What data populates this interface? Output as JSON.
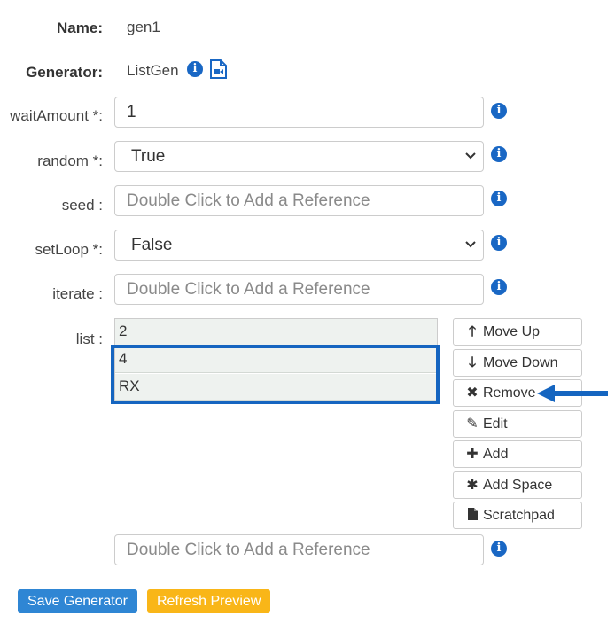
{
  "name": {
    "label": "Name:",
    "value": "gen1"
  },
  "generator": {
    "label": "Generator:",
    "value": "ListGen"
  },
  "fields": {
    "waitAmount": {
      "label": "waitAmount *:",
      "value": "1"
    },
    "random": {
      "label": "random *:",
      "value": "True"
    },
    "seed": {
      "label": "seed :",
      "placeholder": "Double Click to Add a Reference"
    },
    "setLoop": {
      "label": "setLoop *:",
      "value": "False"
    },
    "iterate": {
      "label": "iterate :",
      "placeholder": "Double Click to Add a Reference"
    },
    "list": {
      "label": "list :",
      "items": [
        "2",
        "4",
        "RX"
      ]
    },
    "list_reference": {
      "placeholder": "Double Click to Add a Reference"
    }
  },
  "list_buttons": {
    "move_up": "Move Up",
    "move_down": "Move Down",
    "remove": "Remove",
    "edit": "Edit",
    "add": "Add",
    "add_space": "Add Space",
    "scratchpad": "Scratchpad"
  },
  "actions": {
    "save": "Save Generator",
    "refresh": "Refresh Preview"
  },
  "icons": {
    "info": "info-circle-icon",
    "video": "video-file-icon",
    "chevron": "chevron-down-icon",
    "arrow_up": "arrow-up-icon",
    "arrow_down": "arrow-down-icon",
    "remove": "x-icon",
    "edit": "pencil-icon",
    "add": "plus-icon",
    "add_space": "asterisk-icon",
    "scratchpad": "file-icon",
    "pointer": "arrow-left-pointer"
  },
  "colors": {
    "info_blue": "#1967c4",
    "highlight": "#1565c0",
    "save_bg": "#2f86d4",
    "refresh_bg": "#f9b618",
    "list_item_bg": "#eef2ef"
  }
}
